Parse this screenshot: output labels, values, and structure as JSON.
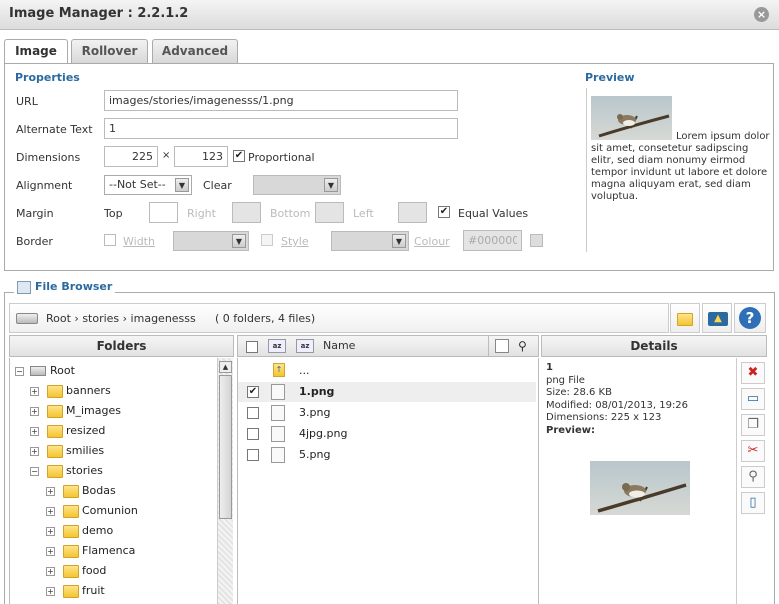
{
  "window": {
    "title": "Image Manager : 2.2.1.2"
  },
  "tabs": [
    {
      "label": "Image"
    },
    {
      "label": "Rollover"
    },
    {
      "label": "Advanced"
    }
  ],
  "properties": {
    "heading": "Properties",
    "url_label": "URL",
    "url_value": "images/stories/imagenesss/1.png",
    "alt_label": "Alternate Text",
    "alt_value": "1",
    "dimensions_label": "Dimensions",
    "width_value": "225",
    "times": "×",
    "height_value": "123",
    "proportional_label": "Proportional",
    "proportional_checked": true,
    "alignment_label": "Alignment",
    "alignment_value": "--Not Set--",
    "clear_label": "Clear",
    "margin_label": "Margin",
    "margin_top": "Top",
    "margin_right": "Right",
    "margin_bottom": "Bottom",
    "margin_left": "Left",
    "equal_values_label": "Equal Values",
    "equal_values_checked": true,
    "border_label": "Border",
    "border_width_label": "Width",
    "border_style_label": "Style",
    "border_colour_label": "Colour",
    "border_colour_value": "#000000"
  },
  "preview": {
    "heading": "Preview",
    "text": "Lorem ipsum dolor sit amet, consetetur sadipscing elitr, sed diam nonumy eirmod tempor invidunt ut labore et dolore magna aliquyam erat, sed diam voluptua."
  },
  "file_browser": {
    "legend": "File Browser",
    "breadcrumb": "Root › stories › imagenesss",
    "summary": "( 0 folders, 4 files)",
    "folders_header": "Folders",
    "name_header": "Name",
    "details_header": "Details",
    "tree": [
      {
        "label": "Root",
        "level": 0,
        "toggle": "−"
      },
      {
        "label": "banners",
        "level": 1,
        "toggle": "+"
      },
      {
        "label": "M_images",
        "level": 1,
        "toggle": "+"
      },
      {
        "label": "resized",
        "level": 1,
        "toggle": "+"
      },
      {
        "label": "smilies",
        "level": 1,
        "toggle": "+"
      },
      {
        "label": "stories",
        "level": 1,
        "toggle": "−"
      },
      {
        "label": "Bodas",
        "level": 2,
        "toggle": "+"
      },
      {
        "label": "Comunion",
        "level": 2,
        "toggle": "+"
      },
      {
        "label": "demo",
        "level": 2,
        "toggle": "+"
      },
      {
        "label": "Flamenca",
        "level": 2,
        "toggle": "+"
      },
      {
        "label": "food",
        "level": 2,
        "toggle": "+"
      },
      {
        "label": "fruit",
        "level": 2,
        "toggle": "+"
      }
    ],
    "files": [
      {
        "name": "...",
        "type": "up",
        "checked": false
      },
      {
        "name": "1.png",
        "type": "file",
        "checked": true,
        "selected": true
      },
      {
        "name": "3.png",
        "type": "file",
        "checked": false
      },
      {
        "name": "4jpg.png",
        "type": "file",
        "checked": false
      },
      {
        "name": "5.png",
        "type": "file",
        "checked": false
      }
    ],
    "details": {
      "name": "1",
      "type": "png File",
      "size": "Size: 28.6 KB",
      "modified": "Modified: 08/01/2013, 19:26",
      "dimensions": "Dimensions: 225 x 123",
      "preview_label": "Preview:"
    }
  },
  "colors": {
    "accent": "#2b6aa0",
    "delete": "#cc2222"
  }
}
